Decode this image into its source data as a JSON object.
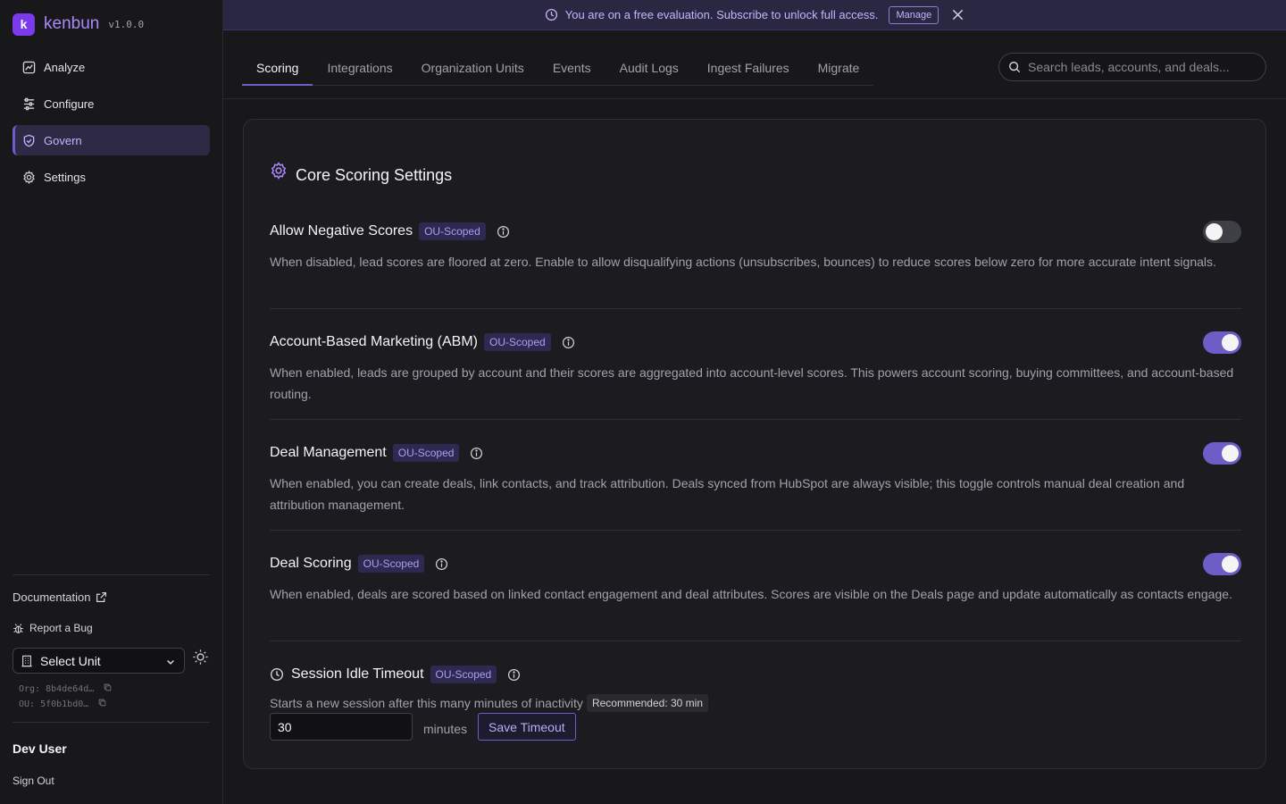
{
  "app": {
    "name": "kenbun",
    "version": "v1.0.0",
    "logo_glyph": "k"
  },
  "sidebar": {
    "items": [
      {
        "label": "Analyze",
        "icon": "chart-icon",
        "active": false
      },
      {
        "label": "Configure",
        "icon": "sliders-icon",
        "active": false
      },
      {
        "label": "Govern",
        "icon": "shield-check-icon",
        "active": true
      },
      {
        "label": "Settings",
        "icon": "gear-icon",
        "active": false
      }
    ],
    "documentation": "Documentation",
    "report_bug": "Report a Bug",
    "unit_select": "Select Unit",
    "org_id": "Org: 8b4de64d…",
    "ou_id": "OU: 5f0b1bd0…",
    "user_name": "Dev User",
    "sign_out": "Sign Out"
  },
  "banner": {
    "text": "You are on a free evaluation. Subscribe to unlock full access.",
    "manage_label": "Manage"
  },
  "tabs": [
    "Scoring",
    "Integrations",
    "Organization Units",
    "Events",
    "Audit Logs",
    "Ingest Failures",
    "Migrate"
  ],
  "active_tab": "Scoring",
  "search": {
    "placeholder": "Search leads, accounts, and deals..."
  },
  "card": {
    "title": "Core Scoring Settings",
    "settings": [
      {
        "title": "Allow Negative Scores",
        "badge": "OU-Scoped",
        "enabled": false,
        "description": "When disabled, lead scores are floored at zero. Enable to allow disqualifying actions (unsubscribes, bounces) to reduce scores below zero for more accurate intent signals."
      },
      {
        "title": "Account-Based Marketing (ABM)",
        "badge": "OU-Scoped",
        "enabled": true,
        "description": "When enabled, leads are grouped by account and their scores are aggregated into account-level scores. This powers account scoring, buying committees, and account-based routing."
      },
      {
        "title": "Deal Management",
        "badge": "OU-Scoped",
        "enabled": true,
        "description": "When enabled, you can create deals, link contacts, and track attribution. Deals synced from HubSpot are always visible; this toggle controls manual deal creation and attribution management."
      },
      {
        "title": "Deal Scoring",
        "badge": "OU-Scoped",
        "enabled": true,
        "description": "When enabled, deals are scored based on linked contact engagement and deal attributes. Scores are visible on the Deals page and update automatically as contacts engage."
      }
    ],
    "session": {
      "title": "Session Idle Timeout",
      "badge": "OU-Scoped",
      "label": "Starts a new session after this many minutes of inactivity",
      "recommended": "Recommended: 30 min",
      "value": "30",
      "unit": "minutes",
      "save_label": "Save Timeout"
    }
  },
  "colors": {
    "accent": "#6d5ec7",
    "badge_text": "#a99ff0",
    "background": "#18181b"
  }
}
